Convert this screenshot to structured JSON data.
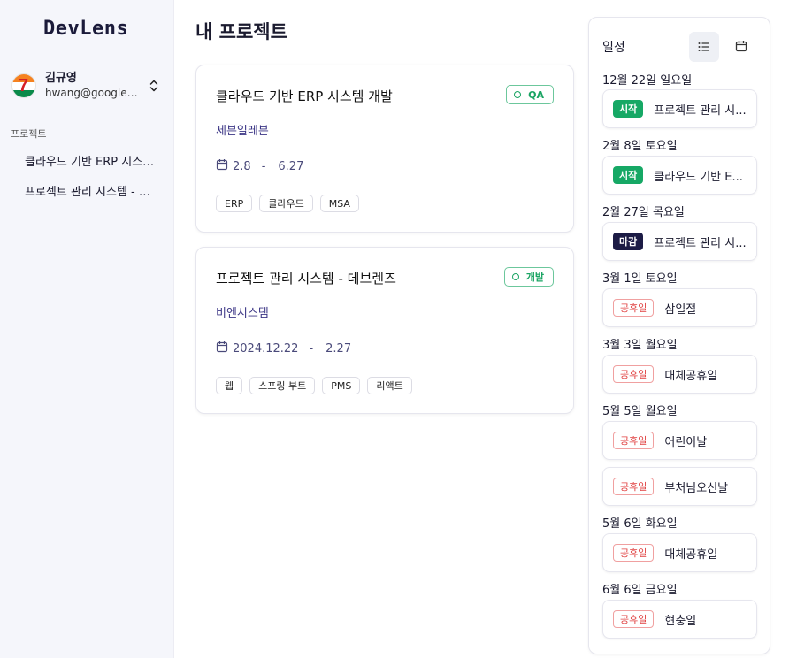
{
  "app": {
    "logo": "DevLens"
  },
  "user": {
    "name": "김규영",
    "email": "hwang@google.c..."
  },
  "sidebar": {
    "section_label": "프로젝트",
    "items": [
      {
        "label": "클라우드 기반 ERP 시스템..."
      },
      {
        "label": "프로젝트 관리 시스템 - 데..."
      }
    ]
  },
  "main": {
    "title": "내 프로젝트",
    "projects": [
      {
        "title": "클라우드 기반 ERP 시스템 개발",
        "status": "QA",
        "company": "세븐일레븐",
        "start": "2.8",
        "separator": "-",
        "end": "6.27",
        "tags": [
          "ERP",
          "클라우드",
          "MSA"
        ]
      },
      {
        "title": "프로젝트 관리 시스템 - 데브렌즈",
        "status": "개발",
        "company": "비엔시스템",
        "start": "2024.12.22",
        "separator": "-",
        "end": "2.27",
        "tags": [
          "웹",
          "스프링 부트",
          "PMS",
          "리액트"
        ]
      }
    ]
  },
  "schedule": {
    "title": "일정",
    "groups": [
      {
        "date": "12월 22일 일요일",
        "events": [
          {
            "type": "시작",
            "kind": "start",
            "label": "프로젝트 관리 시..."
          }
        ]
      },
      {
        "date": "2월 8일 토요일",
        "events": [
          {
            "type": "시작",
            "kind": "start",
            "label": "클라우드 기반 E..."
          }
        ]
      },
      {
        "date": "2월 27일 목요일",
        "events": [
          {
            "type": "마감",
            "kind": "end",
            "label": "프로젝트 관리 시..."
          }
        ]
      },
      {
        "date": "3월 1일 토요일",
        "events": [
          {
            "type": "공휴일",
            "kind": "holiday",
            "label": "삼일절"
          }
        ]
      },
      {
        "date": "3월 3일 월요일",
        "events": [
          {
            "type": "공휴일",
            "kind": "holiday",
            "label": "대체공휴일"
          }
        ]
      },
      {
        "date": "5월 5일 월요일",
        "events": [
          {
            "type": "공휴일",
            "kind": "holiday",
            "label": "어린이날"
          },
          {
            "type": "공휴일",
            "kind": "holiday",
            "label": "부처님오신날"
          }
        ]
      },
      {
        "date": "5월 6일 화요일",
        "events": [
          {
            "type": "공휴일",
            "kind": "holiday",
            "label": "대체공휴일"
          }
        ]
      },
      {
        "date": "6월 6일 금요일",
        "events": [
          {
            "type": "공휴일",
            "kind": "holiday",
            "label": "현충일"
          }
        ]
      }
    ]
  },
  "colors": {
    "accent_green": "#16a865",
    "deadline_navy": "#1c1b45",
    "holiday_red": "#e04141",
    "company_text": "#3b3585"
  },
  "icons": [
    "chevron-updown-icon",
    "calendar-icon",
    "list-icon",
    "circle-icon"
  ]
}
